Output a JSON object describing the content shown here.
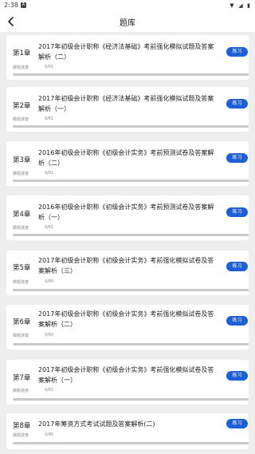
{
  "status_bar": {
    "time": "2:38",
    "notification_icon": "a-icon",
    "wifi_icon": "wifi-icon",
    "signal_icon": "signal-icon",
    "battery_icon": "battery-icon"
  },
  "header": {
    "title": "题库",
    "back_icon": "chevron-left-icon"
  },
  "colors": {
    "accent": "#1d5fd6",
    "background": "#eeeeee",
    "card": "#ffffff",
    "progress_track": "#c9c9c9"
  },
  "chapters": [
    {
      "chapter": "第1章",
      "title": "2017年初级会计职称《经济法基础》考前强化模拟试题及答案解析（二）",
      "progress_label": "做题进度",
      "progress_count": "0/61",
      "button": "练习",
      "progress": 0
    },
    {
      "chapter": "第2章",
      "title": "2017年初级会计职称《经济法基础》考前强化模拟试题及答案解析（一）",
      "progress_label": "做题进度",
      "progress_count": "0/61",
      "button": "练习",
      "progress": 0
    },
    {
      "chapter": "第3章",
      "title": "2016年初级会计职称《初级会计实务》考前预测试卷及答案解析（二）",
      "progress_label": "做题进度",
      "progress_count": "0/61",
      "button": "练习",
      "progress": 0
    },
    {
      "chapter": "第4章",
      "title": "2016年初级会计职称《初级会计实务》考前预测试卷及答案解析（一）",
      "progress_label": "做题进度",
      "progress_count": "0/61",
      "button": "练习",
      "progress": 0
    },
    {
      "chapter": "第5章",
      "title": "2017年初级会计职称《初级会计实务》考前强化模拟试卷及答案解析（三）",
      "progress_label": "做题进度",
      "progress_count": "0/60",
      "button": "练习",
      "progress": 0
    },
    {
      "chapter": "第6章",
      "title": "2017年初级会计职称《初级会计实务》考前强化模拟试卷及答案解析（二）",
      "progress_label": "做题进度",
      "progress_count": "0/60",
      "button": "练习",
      "progress": 0
    },
    {
      "chapter": "第7章",
      "title": "2017年初级会计职称《初级会计实务》考前强化模拟试卷及答案解析（一）",
      "progress_label": "做题进度",
      "progress_count": "0/61",
      "button": "练习",
      "progress": 0
    },
    {
      "chapter": "第8章",
      "title": "2017年筹资方式考试试题及答案解析(二)",
      "progress_label": "做题进度",
      "progress_count": "0/45",
      "button": "练习",
      "progress": 0
    }
  ]
}
